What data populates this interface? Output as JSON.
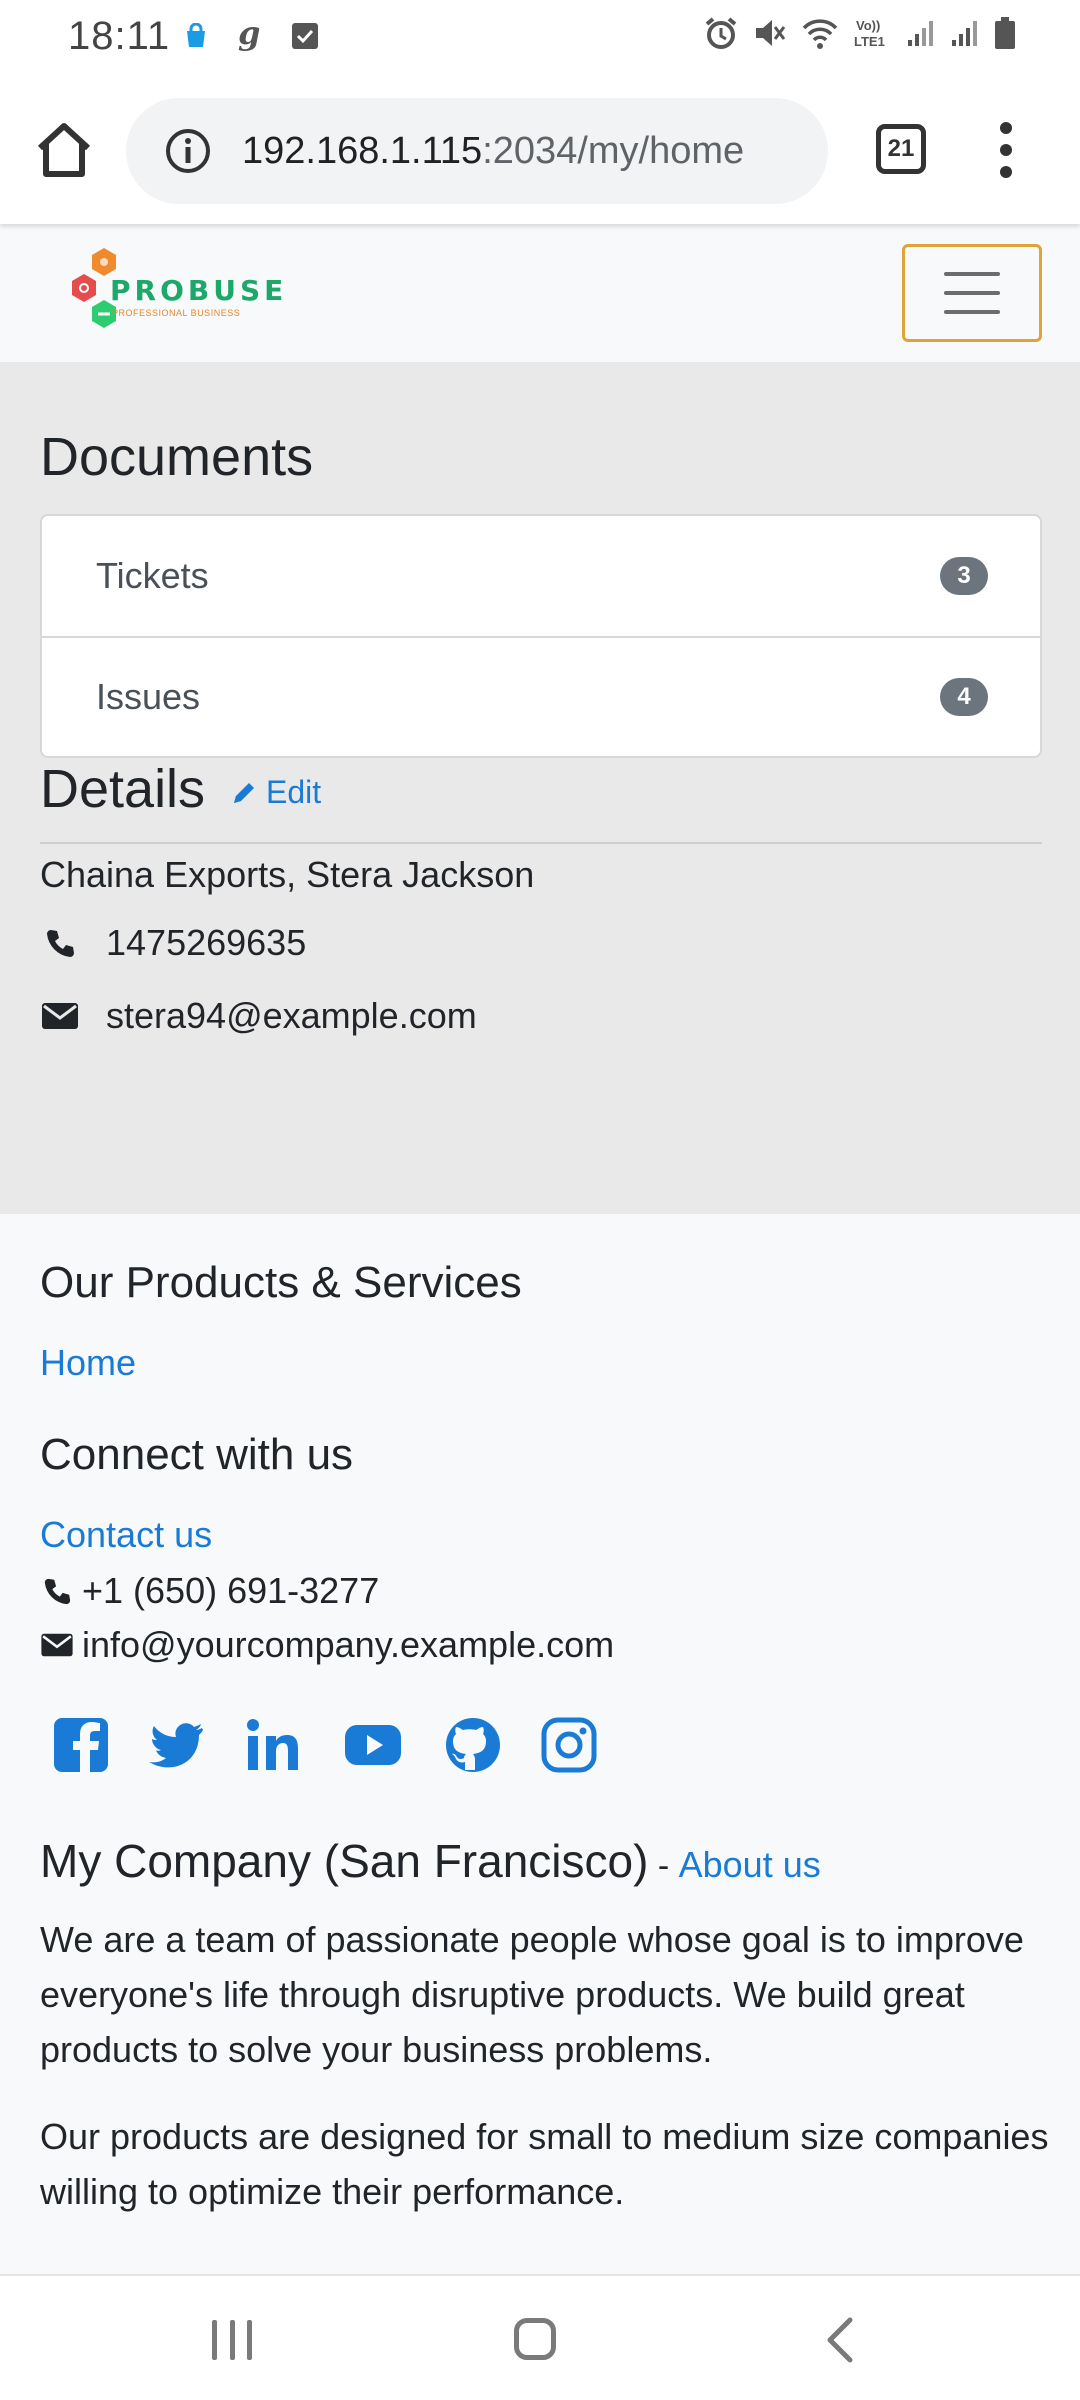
{
  "status_bar": {
    "time": "18:11",
    "left_icons": [
      "shopping-bag-icon",
      "g-app-icon",
      "checkbox-icon"
    ],
    "right_icons": [
      "alarm-icon",
      "mute-icon",
      "wifi-icon",
      "volte-icon",
      "signal-icon",
      "signal-icon",
      "battery-icon"
    ],
    "volte_label": "Vo)) LTE1"
  },
  "browser": {
    "url_host": "192.168.1.115",
    "url_rest": ":2034/my/home",
    "tab_count": "21"
  },
  "navbar": {
    "logo_text": "PROBUSE",
    "logo_subtext": "PROFESSIONAL BUSINESS",
    "accent": "#e0a33a"
  },
  "documents": {
    "title": "Documents",
    "items": [
      {
        "label": "Tickets",
        "count": "3"
      },
      {
        "label": "Issues",
        "count": "4"
      }
    ]
  },
  "details": {
    "title": "Details",
    "edit_label": "Edit",
    "company_contact": "Chaina Exports, Stera Jackson",
    "phone": "1475269635",
    "email": "stera94@example.com"
  },
  "footer": {
    "products_heading": "Our Products & Services",
    "home_link": "Home",
    "connect_heading": "Connect with us",
    "contact_link": "Contact us",
    "phone": "+1 (650) 691-3277",
    "email": "info@yourcompany.example.com",
    "social_icons": [
      "facebook-icon",
      "twitter-icon",
      "linkedin-icon",
      "youtube-icon",
      "github-icon",
      "instagram-icon"
    ],
    "company_name": "My Company (San Francisco)",
    "separator": " - ",
    "about_link": "About us",
    "paragraph_1": "We are a team of passionate people whose goal is to improve everyone's life through disruptive products. We build great products to solve your business problems.",
    "paragraph_2": "Our products are designed for small to medium size companies willing to optimize their performance.",
    "link_color": "#1a7bd6"
  }
}
